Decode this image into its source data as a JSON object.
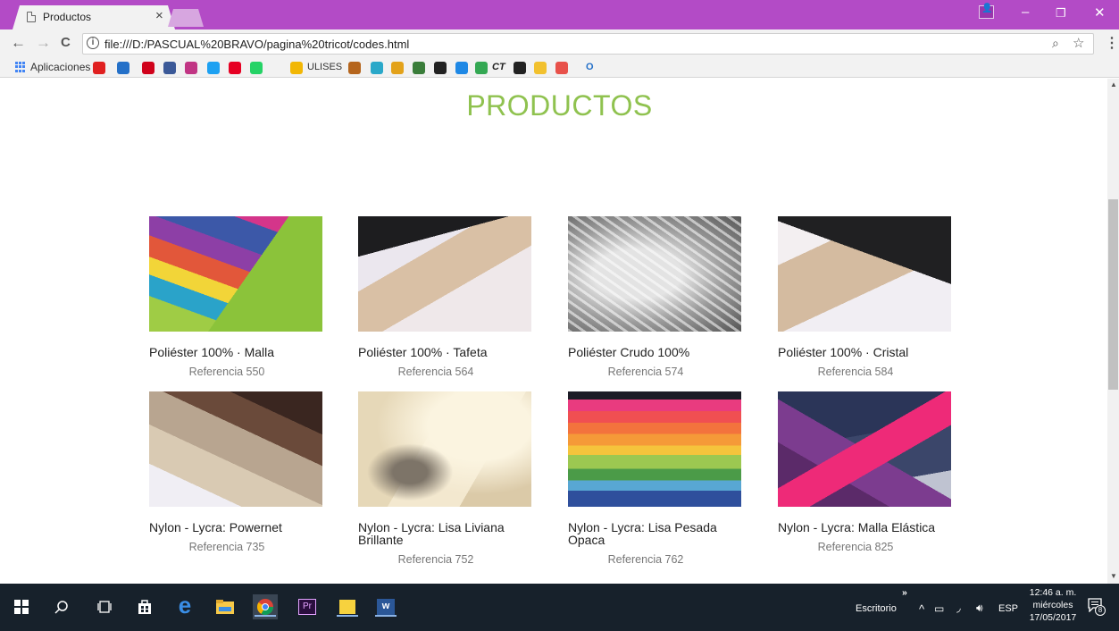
{
  "browser": {
    "tab_title": "Productos",
    "tab_close": "×",
    "url": "file:///D:/PASCUAL%20BRAVO/pagina%20tricot/codes.html",
    "win_controls": [
      "–",
      "❐",
      "✕"
    ],
    "nav": {
      "back": "←",
      "forward": "→",
      "reload": "C"
    },
    "zoom_icon": "⌕",
    "star_icon": "☆",
    "menu_icon": "⋮"
  },
  "bookmarks": {
    "apps_label": "Aplicaciones",
    "ulises_label": "ULISES",
    "ct_label": "CT",
    "o_label": "O",
    "icon_colors": [
      "#e02020",
      "#2470c8",
      "#d0021b",
      "#3b5998",
      "#c13584",
      "#1da1f2",
      "#e60023",
      "#25d366",
      "#f2b705",
      "#b5651d",
      "#2aa8c9",
      "#e3a21a",
      "#3a7d3a",
      "#222222",
      "#1e88e5",
      "#34a853",
      "#222222",
      "#f2c12e",
      "#e8514a",
      "#f06a2a"
    ]
  },
  "page": {
    "title": "PRODUCTOS",
    "products": [
      {
        "name": "Poliéster 100% · Malla",
        "ref": "Referencia 550"
      },
      {
        "name": "Poliéster 100% · Tafeta",
        "ref": "Referencia 564"
      },
      {
        "name": "Poliéster Crudo 100%",
        "ref": "Referencia 574"
      },
      {
        "name": "Poliéster 100% · Cristal",
        "ref": "Referencia 584"
      },
      {
        "name": "Nylon - Lycra: Powernet",
        "ref": "Referencia 735"
      },
      {
        "name": "Nylon - Lycra: Lisa Liviana Brillante",
        "ref": "Referencia 752"
      },
      {
        "name": "Nylon - Lycra: Lisa Pesada Opaca",
        "ref": "Referencia 762"
      },
      {
        "name": "Nylon - Lycra: Malla Elástica",
        "ref": "Referencia 825"
      }
    ]
  },
  "taskbar": {
    "desktop_label": "Escritorio",
    "chevrons": "»",
    "tray_arrow": "^",
    "language": "ESP",
    "time": "12:46 a. m.",
    "day": "miércoles",
    "date": "17/05/2017",
    "notification_count": "8",
    "premiere_label": "Pr",
    "word_label": "w"
  }
}
